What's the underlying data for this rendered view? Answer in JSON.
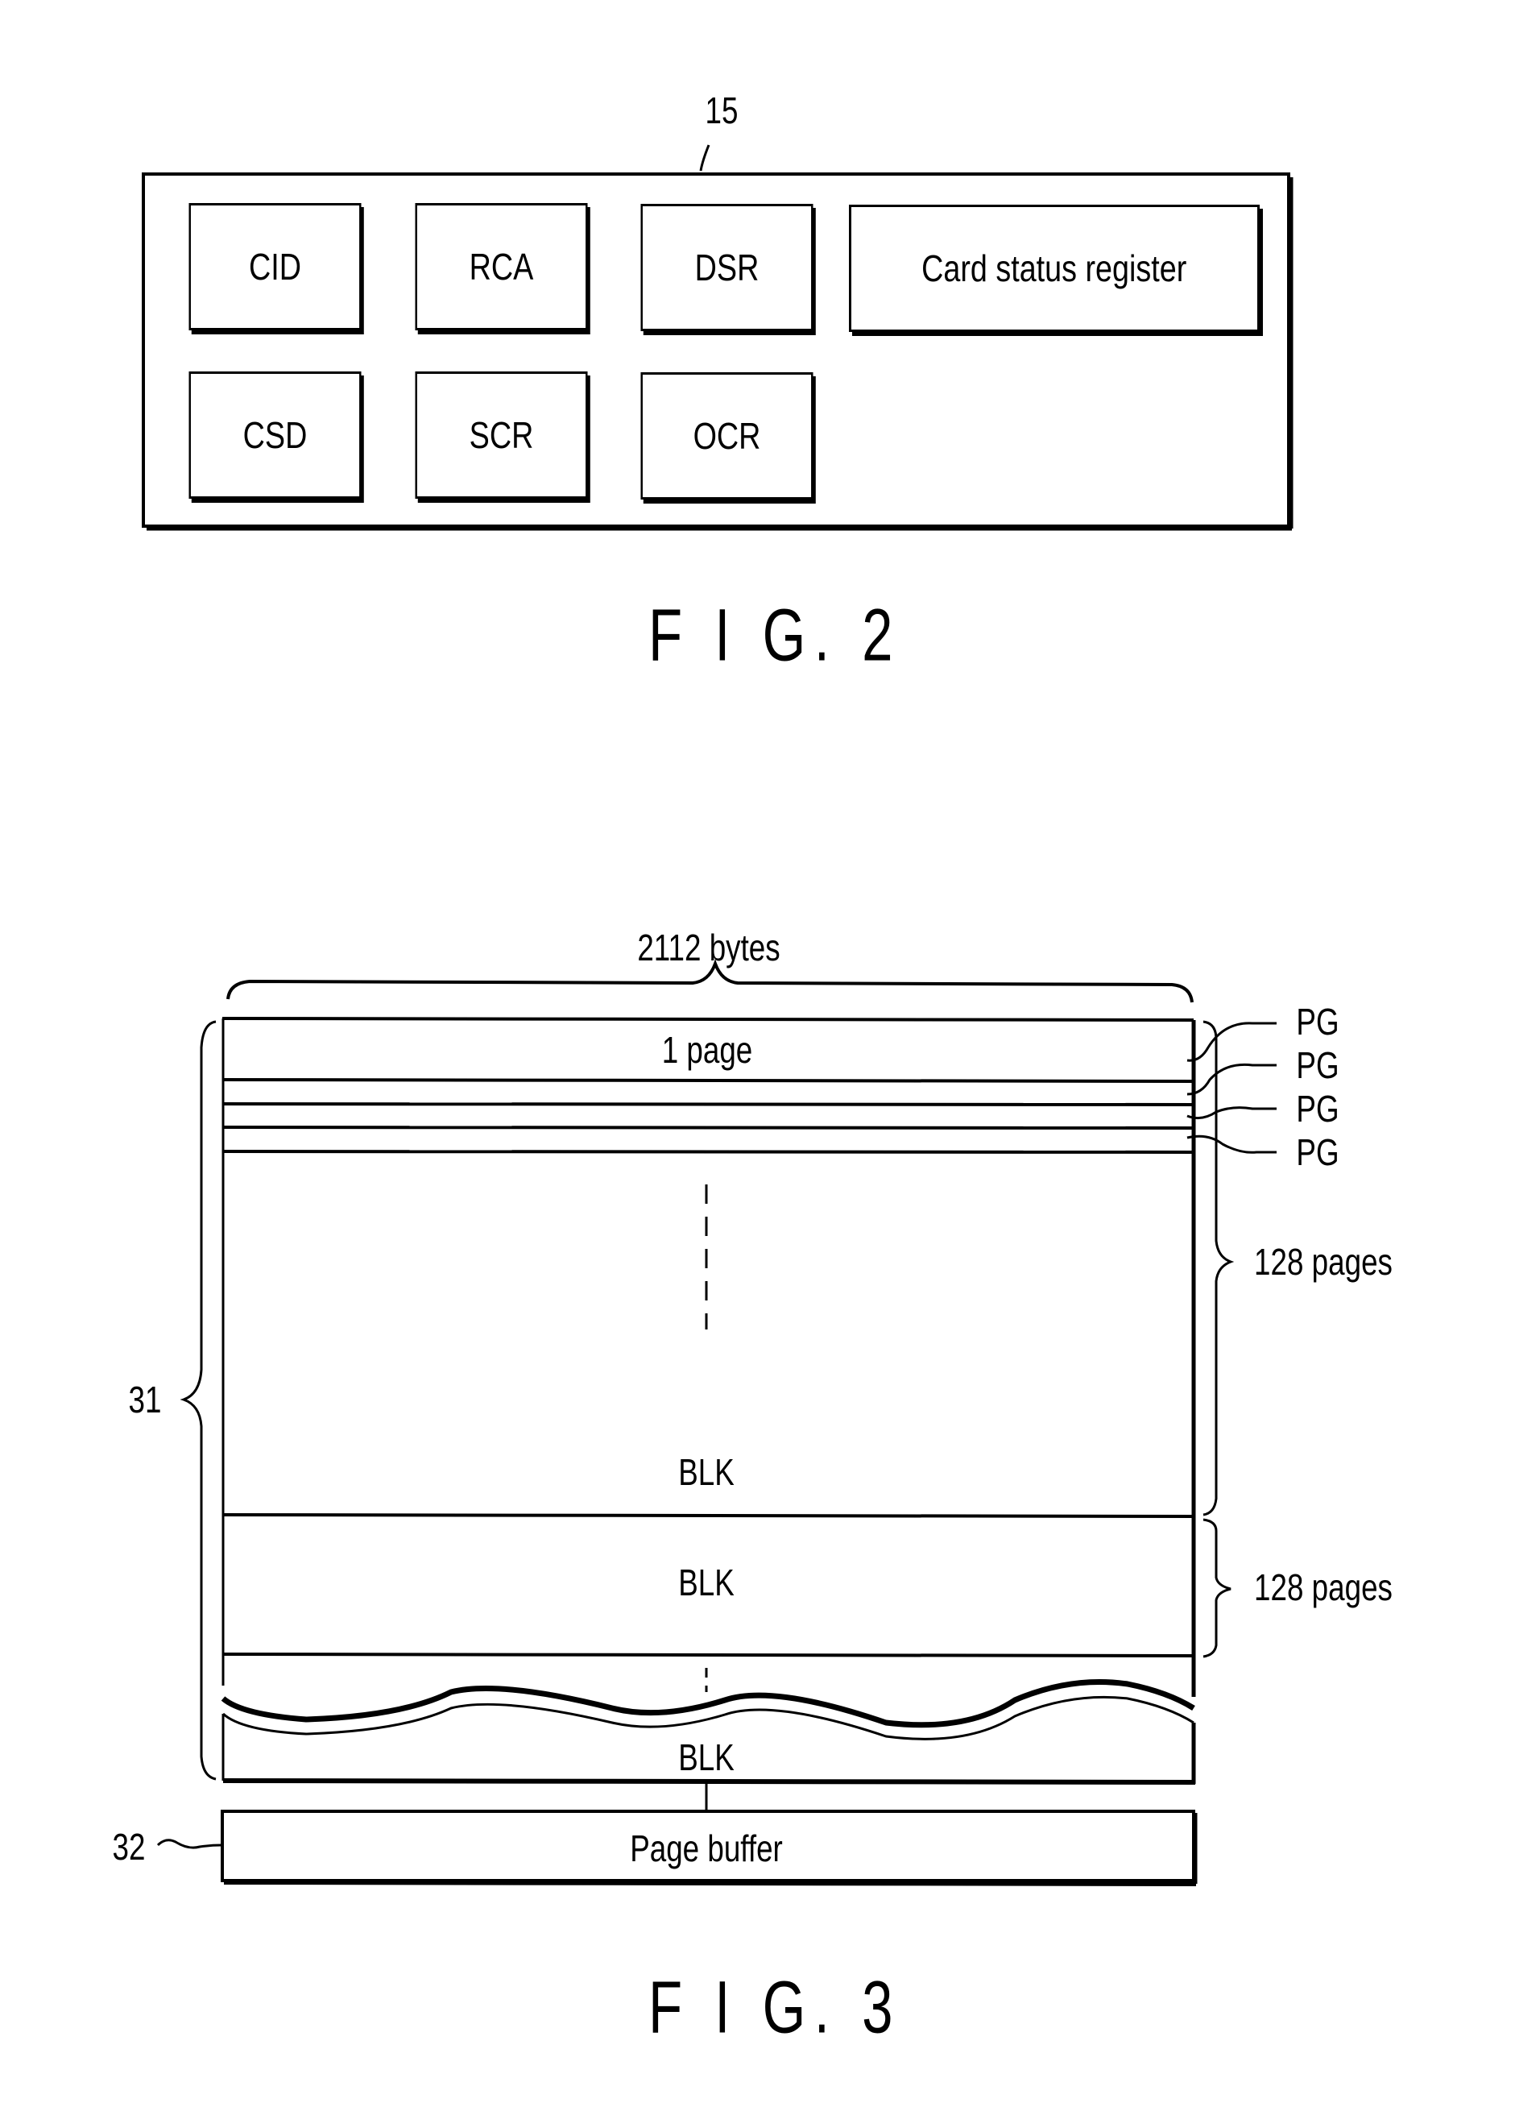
{
  "fig2": {
    "reference": "15",
    "caption": "F I G. 2",
    "registers_row1": [
      "CID",
      "RCA",
      "DSR",
      "Card status register"
    ],
    "registers_row2": [
      "CSD",
      "SCR",
      "OCR"
    ]
  },
  "fig3": {
    "caption": "F I G. 3",
    "width_label": "2112 bytes",
    "page_label": "1 page",
    "page_refs": [
      "PG",
      "PG",
      "PG",
      "PG"
    ],
    "block_labels": [
      "BLK",
      "BLK",
      "BLK"
    ],
    "pages_per_block": [
      "128 pages",
      "128 pages"
    ],
    "memory_ref": "31",
    "buffer_ref": "32",
    "buffer_label": "Page buffer"
  }
}
